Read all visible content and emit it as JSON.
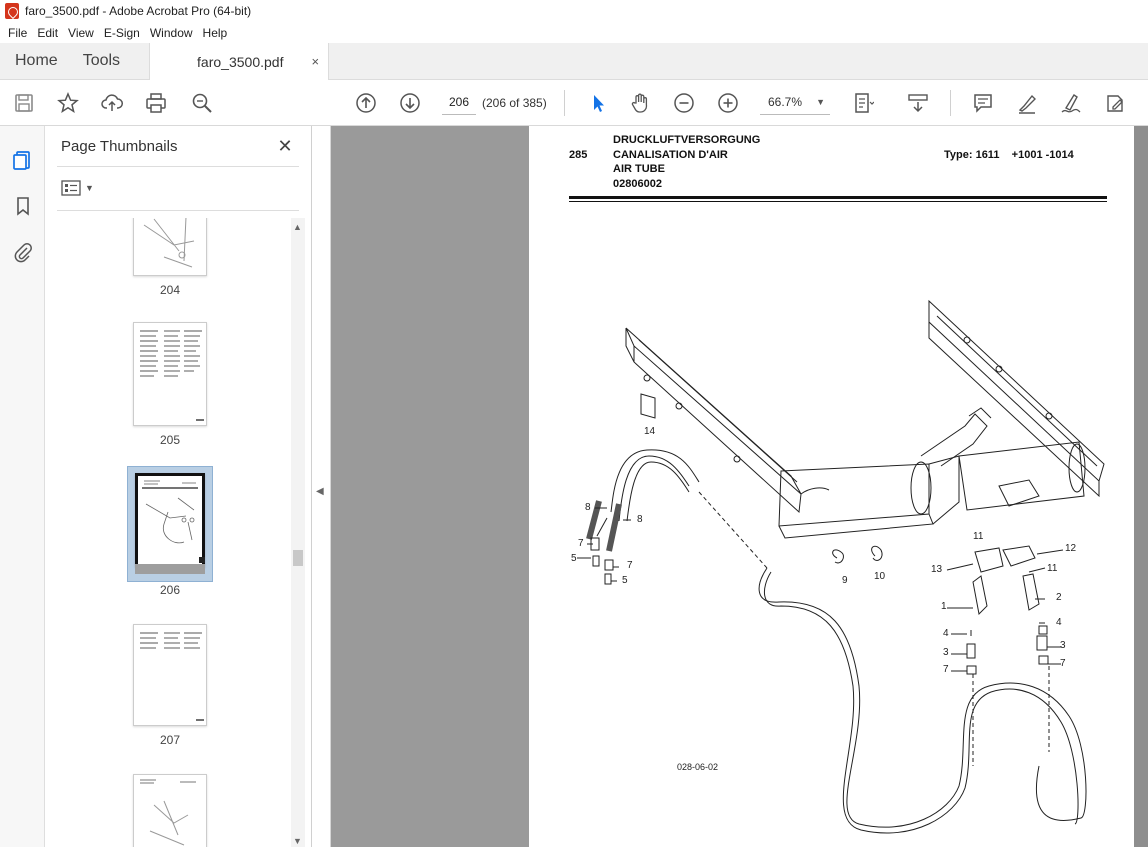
{
  "window": {
    "title": "faro_3500.pdf - Adobe Acrobat Pro (64-bit)"
  },
  "menu": [
    "File",
    "Edit",
    "View",
    "E-Sign",
    "Window",
    "Help"
  ],
  "tabs": {
    "home": "Home",
    "tools": "Tools",
    "document": "faro_3500.pdf",
    "close": "×"
  },
  "toolbar": {
    "page_value": "206",
    "page_count": "(206 of 385)",
    "zoom": "66.7%"
  },
  "thumbnails": {
    "title": "Page Thumbnails",
    "close": "✕",
    "pages": [
      "204",
      "205",
      "206",
      "207"
    ],
    "selected": "206"
  },
  "document": {
    "header_number": "285",
    "title_de": "DRUCKLUFTVERSORGUNG",
    "title_fr": "CANALISATION D'AIR",
    "title_en": "AIR TUBE",
    "part_number": "02806002",
    "type_line": "Type: 1611    +1001 -1014",
    "figure_ref": "028-06-02",
    "callouts": [
      "14",
      "8",
      "8",
      "7",
      "5",
      "7",
      "5",
      "9",
      "10",
      "11",
      "12",
      "13",
      "11",
      "1",
      "2",
      "4",
      "4",
      "3",
      "3",
      "7",
      "7"
    ]
  },
  "colors": {
    "accent": "#1473e6",
    "doc_bg": "#9a9a9a",
    "selection": "#b9cfe4"
  }
}
